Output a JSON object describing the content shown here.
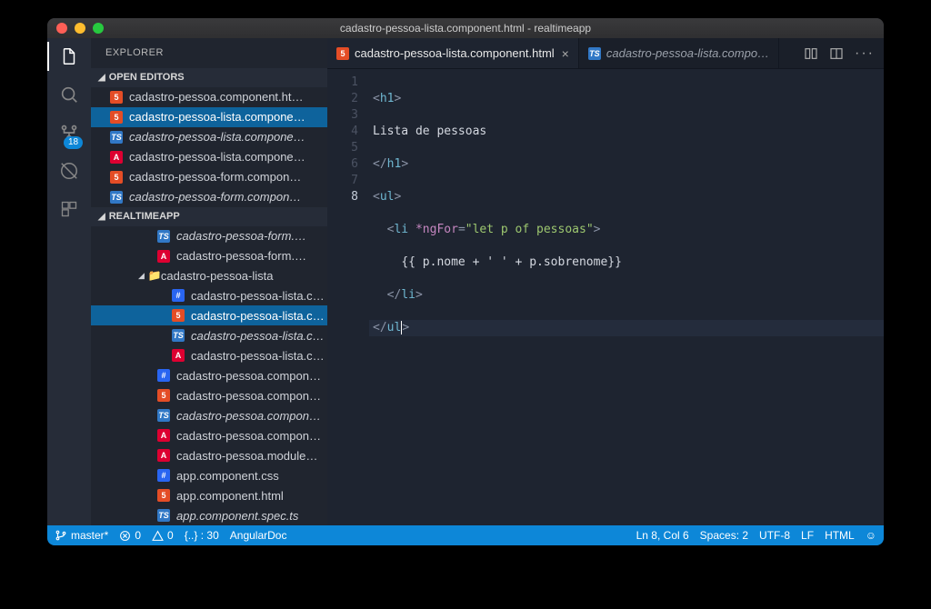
{
  "titlebar": {
    "title": "cadastro-pessoa-lista.component.html - realtimeapp"
  },
  "activity": {
    "badge": "18"
  },
  "sidebar": {
    "title": "EXPLORER",
    "openEditors": {
      "label": "OPEN EDITORS",
      "items": [
        {
          "icon": "html",
          "label": "cadastro-pessoa.component.ht…",
          "selected": false,
          "modified": false
        },
        {
          "icon": "html",
          "label": "cadastro-pessoa-lista.compone…",
          "selected": true,
          "modified": false
        },
        {
          "icon": "ts",
          "label": "cadastro-pessoa-lista.compone…",
          "selected": false,
          "modified": true
        },
        {
          "icon": "ng",
          "label": "cadastro-pessoa-lista.compone…",
          "selected": false,
          "modified": false
        },
        {
          "icon": "html",
          "label": "cadastro-pessoa-form.compon…",
          "selected": false,
          "modified": false
        },
        {
          "icon": "ts",
          "label": "cadastro-pessoa-form.compon…",
          "selected": false,
          "modified": true
        }
      ]
    },
    "project": {
      "label": "REALTIMEAPP",
      "folder": {
        "label": "cadastro-pessoa-lista"
      },
      "pre": [
        {
          "icon": "ts",
          "label": "cadastro-pessoa-form.…",
          "modified": true
        },
        {
          "icon": "ng",
          "label": "cadastro-pessoa-form.…",
          "modified": false
        }
      ],
      "children": [
        {
          "icon": "css",
          "label": "cadastro-pessoa-lista.c…",
          "selected": false
        },
        {
          "icon": "html",
          "label": "cadastro-pessoa-lista.c…",
          "selected": true
        },
        {
          "icon": "ts",
          "label": "cadastro-pessoa-lista.c…",
          "selected": false,
          "modified": true
        },
        {
          "icon": "ng",
          "label": "cadastro-pessoa-lista.c…",
          "selected": false
        }
      ],
      "post": [
        {
          "icon": "css",
          "label": "cadastro-pessoa.compon…"
        },
        {
          "icon": "html",
          "label": "cadastro-pessoa.compon…"
        },
        {
          "icon": "ts",
          "label": "cadastro-pessoa.compon…",
          "modified": true
        },
        {
          "icon": "ng",
          "label": "cadastro-pessoa.compon…"
        },
        {
          "icon": "ng",
          "label": "cadastro-pessoa.module…"
        },
        {
          "icon": "css",
          "label": "app.component.css"
        },
        {
          "icon": "html",
          "label": "app.component.html"
        },
        {
          "icon": "ts",
          "label": "app.component.spec.ts",
          "modified": true
        }
      ]
    }
  },
  "tabs": {
    "active": {
      "icon": "html",
      "label": "cadastro-pessoa-lista.component.html"
    },
    "inactive": {
      "icon": "ts",
      "label": "cadastro-pessoa-lista.compo…"
    }
  },
  "editor": {
    "lines": [
      "1",
      "2",
      "3",
      "4",
      "5",
      "6",
      "7",
      "8"
    ],
    "l1_tag": "h1",
    "l2_text": "Lista de pessoas",
    "l3_tag": "h1",
    "l4_tag": "ul",
    "l5_tag": "li",
    "l5_attr": "*ngFor",
    "l5_str": "\"let p of pessoas\"",
    "l6_text": "{{ p.nome + ' ' + p.sobrenome}}",
    "l7_tag": "li",
    "l8_tag": "ul"
  },
  "status": {
    "branch": "master*",
    "errors": "0",
    "warnings": "0",
    "prettier": "{..} : 30",
    "angular": "AngularDoc",
    "pos": "Ln 8, Col 6",
    "spaces": "Spaces: 2",
    "enc": "UTF-8",
    "eol": "LF",
    "lang": "HTML"
  }
}
